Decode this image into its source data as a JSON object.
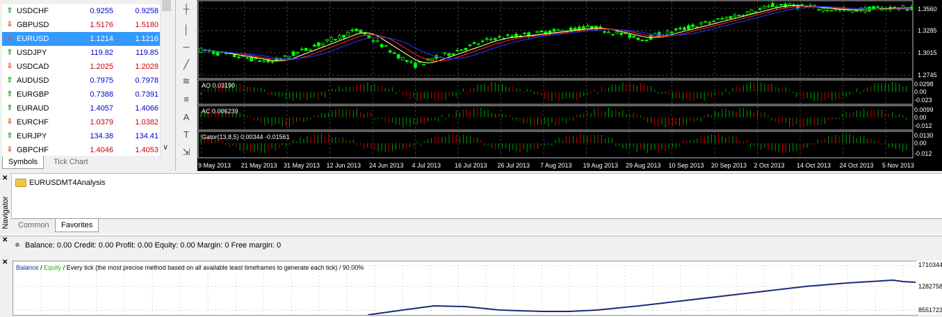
{
  "market_watch": {
    "rows": [
      {
        "symbol": "USDCHF",
        "bid": "0.9255",
        "ask": "0.9258",
        "dir": "up",
        "bid_color": "#0000cc",
        "ask_color": "#0000cc"
      },
      {
        "symbol": "GBPUSD",
        "bid": "1.5176",
        "ask": "1.5180",
        "dir": "down",
        "bid_color": "#cc0000",
        "ask_color": "#cc0000"
      },
      {
        "symbol": "EURUSD",
        "bid": "1.1214",
        "ask": "1.1216",
        "dir": "down",
        "bid_color": "#ffffff",
        "ask_color": "#ffffff",
        "selected": true
      },
      {
        "symbol": "USDJPY",
        "bid": "119.82",
        "ask": "119.85",
        "dir": "up",
        "bid_color": "#0000cc",
        "ask_color": "#0000cc"
      },
      {
        "symbol": "USDCAD",
        "bid": "1.2025",
        "ask": "1.2028",
        "dir": "down",
        "bid_color": "#cc0000",
        "ask_color": "#cc0000"
      },
      {
        "symbol": "AUDUSD",
        "bid": "0.7975",
        "ask": "0.7978",
        "dir": "up",
        "bid_color": "#0000cc",
        "ask_color": "#0000cc"
      },
      {
        "symbol": "EURGBP",
        "bid": "0.7388",
        "ask": "0.7391",
        "dir": "up",
        "bid_color": "#0000cc",
        "ask_color": "#0000cc"
      },
      {
        "symbol": "EURAUD",
        "bid": "1.4057",
        "ask": "1.4066",
        "dir": "up",
        "bid_color": "#0000cc",
        "ask_color": "#0000cc"
      },
      {
        "symbol": "EURCHF",
        "bid": "1.0379",
        "ask": "1.0382",
        "dir": "down",
        "bid_color": "#cc0000",
        "ask_color": "#cc0000"
      },
      {
        "symbol": "EURJPY",
        "bid": "134.38",
        "ask": "134.41",
        "dir": "up",
        "bid_color": "#0000cc",
        "ask_color": "#0000cc"
      },
      {
        "symbol": "GBPCHF",
        "bid": "1.4046",
        "ask": "1.4053",
        "dir": "down",
        "bid_color": "#cc0000",
        "ask_color": "#cc0000"
      }
    ],
    "tabs": [
      "Symbols",
      "Tick Chart"
    ]
  },
  "toolbar_icons": [
    "crosshair-icon",
    "vertical-line-icon",
    "horizontal-line-icon",
    "trendline-icon",
    "fibonacci-icon",
    "channel-icon",
    "text-icon",
    "text-label-icon",
    "arrows-icon"
  ],
  "toolbar_glyphs": [
    "┼",
    "│",
    "─",
    "╱",
    "≋",
    "≡",
    "A",
    "T",
    "⇲"
  ],
  "chart": {
    "price_labels": [
      "1.3560",
      "1.3285",
      "1.3015",
      "1.2745"
    ],
    "indicators": [
      {
        "label": "AO 0.03190",
        "scale": [
          "0.0298",
          "0.00",
          "-0.023"
        ]
      },
      {
        "label": "AC 0.006239",
        "scale": [
          "0.0099",
          "0.00",
          "-0.012"
        ]
      },
      {
        "label": "Gator(13,8,5) 0.00344 -0.01561",
        "scale": [
          "0.0130",
          "0.00",
          "-0.012"
        ]
      }
    ],
    "dates": [
      "9 May 2013",
      "21 May 2013",
      "31 May 2013",
      "12 Jun 2013",
      "24 Jun 2013",
      "4 Jul 2013",
      "16 Jul 2013",
      "26 Jul 2013",
      "7 Aug 2013",
      "19 Aug 2013",
      "29 Aug 2013",
      "10 Sep 2013",
      "20 Sep 2013",
      "2 Oct 2013",
      "14 Oct 2013",
      "24 Oct 2013",
      "5 Nov 2013"
    ],
    "colors": {
      "bull": "#00ff00",
      "bear": "#00ff00",
      "ma1": "#ffff99",
      "ma2": "#ff2222",
      "ma3": "#2233ff",
      "ind_up": "#00a000",
      "ind_down": "#d00000"
    }
  },
  "navigator": {
    "label": "Navigator",
    "item": "EURUSDMT4Analysis",
    "tabs": [
      "Common",
      "Favorites"
    ]
  },
  "terminal": {
    "status": "Balance: 0.00  Credit: 0.00  Profit: 0.00  Equity: 0.00  Margin: 0  Free margin: 0"
  },
  "tester_graph": {
    "legend_balance": "Balance",
    "legend_sep": " / ",
    "legend_equity": "Equity",
    "legend_rest": " / Every tick (the most precise method based on all available least timeframes to generate each tick) / 90.00%",
    "scale": [
      "1710344",
      "1282758",
      "8551723"
    ],
    "balance_color": "#1a2a7a",
    "equity_color": "#22aa22"
  }
}
